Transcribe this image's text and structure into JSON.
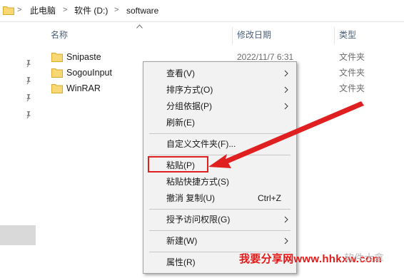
{
  "address_bar": {
    "crumbs": [
      "此电脑",
      "软件 (D:)",
      "software"
    ],
    "separator": ">"
  },
  "columns": {
    "name": "名称",
    "date": "修改日期",
    "type": "类型"
  },
  "files": [
    {
      "name": "Snipaste",
      "date": "2022/11/7 6:31",
      "type": "文件夹"
    },
    {
      "name": "SogouInput",
      "date": "",
      "type": "文件夹"
    },
    {
      "name": "WinRAR",
      "date": "",
      "type": "文件夹"
    }
  ],
  "context_menu": {
    "items": [
      {
        "label": "查看(V)",
        "shortcut": "",
        "submenu": true
      },
      {
        "label": "排序方式(O)",
        "shortcut": "",
        "submenu": true
      },
      {
        "label": "分组依据(P)",
        "shortcut": "",
        "submenu": true
      },
      {
        "label": "刷新(E)",
        "shortcut": "",
        "submenu": false
      },
      {
        "label": "自定义文件夹(F)...",
        "shortcut": "",
        "submenu": false
      },
      {
        "label": "粘贴(P)",
        "shortcut": "",
        "submenu": false
      },
      {
        "label": "粘贴快捷方式(S)",
        "shortcut": "",
        "submenu": false
      },
      {
        "label": "撤消 复制(U)",
        "shortcut": "Ctrl+Z",
        "submenu": false
      },
      {
        "label": "授予访问权限(G)",
        "shortcut": "",
        "submenu": true
      },
      {
        "label": "新建(W)",
        "shortcut": "",
        "submenu": true
      },
      {
        "label": "属性(R)",
        "shortcut": "",
        "submenu": false
      }
    ]
  },
  "watermark": {
    "text": "我要分享网www.hhkxw.com",
    "faint_text": "软件大拿"
  },
  "colors": {
    "folder_yellow": "#f8d775",
    "highlight_red": "#e02020",
    "watermark_red": "#e41818",
    "menu_bg": "#f2f2f2"
  }
}
